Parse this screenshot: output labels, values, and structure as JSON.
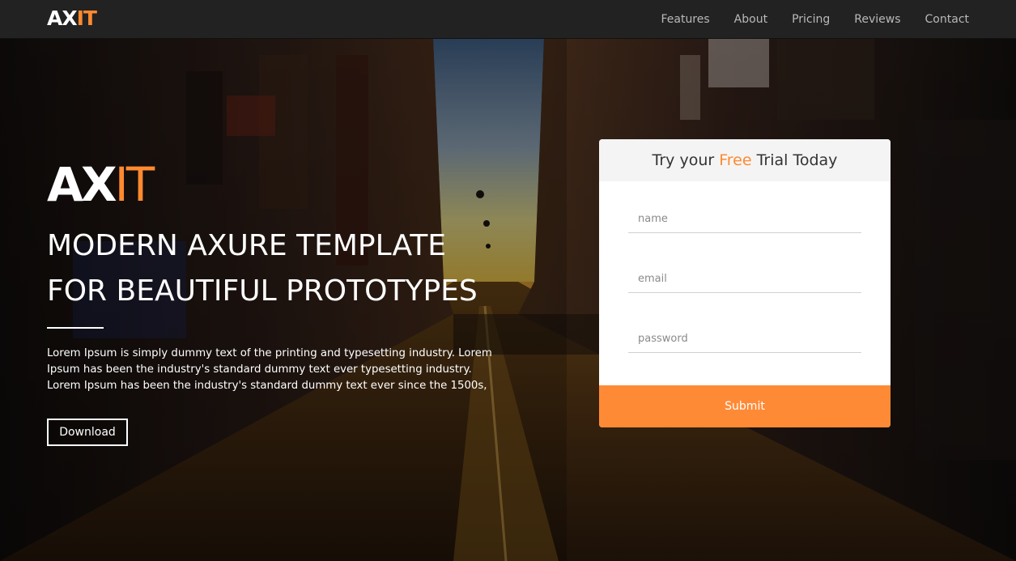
{
  "nav": {
    "logo_main": "AX",
    "logo_accent": "IT",
    "links": [
      "Features",
      "About",
      "Pricing",
      "Reviews",
      "Contact"
    ]
  },
  "hero": {
    "brand_main": "AX",
    "brand_accent": "IT",
    "headline_line1": "MODERN AXURE TEMPLATE",
    "headline_line2": "FOR BEAUTIFUL PROTOTYPES",
    "description": "Lorem Ipsum is simply dummy text of the printing and typesetting industry. Lorem Ipsum has been the industry's standard dummy text ever typesetting industry. Lorem Ipsum has been the industry's standard dummy text ever since the 1500s,",
    "download_label": "Download"
  },
  "trial_form": {
    "title_prefix": "Try your",
    "title_accent": "Free",
    "title_suffix": "Trial Today",
    "name_placeholder": "name",
    "email_placeholder": "email",
    "password_placeholder": "password",
    "submit_label": "Submit"
  },
  "colors": {
    "accent": "#ff8a30",
    "navbar": "#222222",
    "submit": "#ff8a36"
  }
}
